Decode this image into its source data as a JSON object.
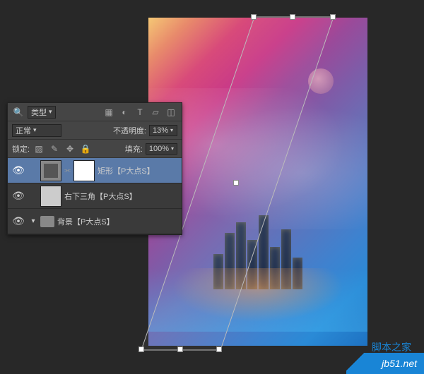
{
  "panel": {
    "filter_label": "类型",
    "blend_mode": "正常",
    "opacity_label": "不透明度:",
    "opacity_value": "13%",
    "lock_label": "锁定:",
    "fill_label": "填充:",
    "fill_value": "100%"
  },
  "toolbar_icons": {
    "search": "search-icon",
    "image": "image-filter-icon",
    "adjust": "adjustment-filter-icon",
    "type": "type-filter-icon",
    "shape": "shape-filter-icon",
    "smart": "smart-filter-icon"
  },
  "lock_icons": {
    "transparency": "lock-transparency-icon",
    "brush": "lock-pixels-icon",
    "move": "lock-position-icon",
    "all": "lock-all-icon"
  },
  "layers": {
    "items": [
      {
        "name": "矩形【P大点S】",
        "selected": true,
        "has_mask": true
      },
      {
        "name": "右下三角【P大点S】",
        "selected": false,
        "has_mask": false
      },
      {
        "name": "背景【P大点S】",
        "selected": false,
        "is_folder": true
      }
    ]
  },
  "watermark": {
    "top_text": "脚本之家",
    "bottom_text": "jb51.net"
  }
}
